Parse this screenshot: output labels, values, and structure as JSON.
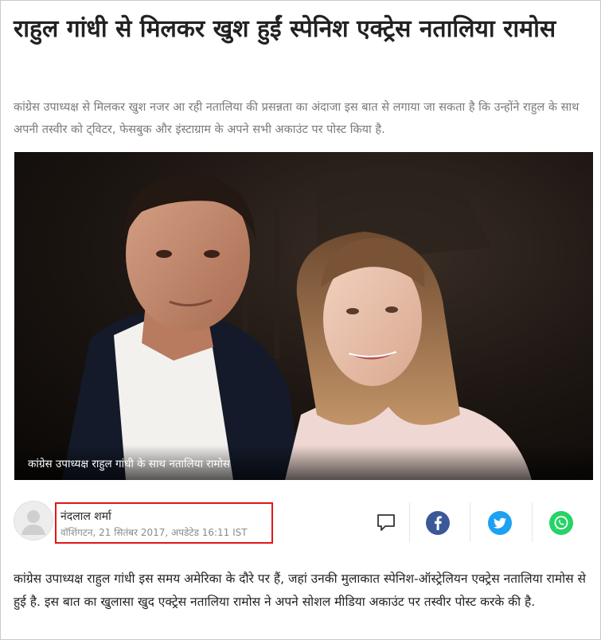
{
  "article": {
    "headline": "राहुल गांधी से मिलकर खुश हुईं स्पेनिश एक्ट्रेस नतालिया रामोस",
    "summary": "कांग्रेस उपाध्यक्ष से मिलकर खुश नजर आ रही नतालिया की प्रसन्नता का अंदाजा इस बात से लगाया जा सकता है कि उन्होंने राहुल के साथ अपनी तस्वीर को ट्विटर, फेसबुक और इंस्टाग्राम के अपने सभी अकाउंट पर पोस्ट किया है.",
    "image_caption": "कांग्रेस उपाध्यक्ष राहुल गांधी के साथ नतालिया रामोस",
    "body": "कांग्रेस उपाध्यक्ष राहुल गांधी इस समय अमेरिका के दौरे पर हैं, जहां उनकी मुलाकात स्पेनिश-ऑस्ट्रेलियन एक्ट्रेस नतालिया रामोस से हुई है. इस बात का खुलासा खुद एक्ट्रेस नतालिया रामोस ने अपने सोशल मीडिया अकाउंट पर तस्वीर पोस्ट करके की है."
  },
  "byline": {
    "author": "नंदलाल शर्मा",
    "meta": "वॉशिंगटन, 21 सितंबर 2017, अपडेटेड 16:11 IST",
    "highlight_color": "#e01818"
  },
  "share": {
    "comment_icon": "comment-icon",
    "facebook": {
      "icon": "facebook-icon",
      "color": "#3b5998"
    },
    "twitter": {
      "icon": "twitter-icon",
      "color": "#1da1f2"
    },
    "whatsapp": {
      "icon": "whatsapp-icon",
      "color": "#25d366"
    }
  }
}
